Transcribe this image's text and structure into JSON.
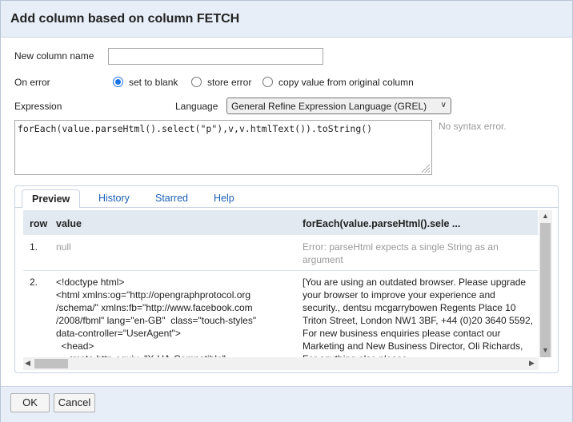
{
  "dialog": {
    "title": "Add column based on column FETCH"
  },
  "form": {
    "new_column_label": "New column name",
    "new_column_value": "",
    "on_error_label": "On error",
    "on_error_options": [
      "set to blank",
      "store error",
      "copy value from original column"
    ],
    "on_error_selected": "set to blank",
    "expression_label": "Expression",
    "language_label": "Language",
    "language_value": "General Refine Expression Language (GREL)",
    "expression_value": "forEach(value.parseHtml().select(\"p\"),v,v.htmlText()).toString()",
    "syntax_status": "No syntax error."
  },
  "tabs": [
    "Preview",
    "History",
    "Starred",
    "Help"
  ],
  "active_tab": "Preview",
  "preview": {
    "columns": [
      "row",
      "value",
      "forEach(value.parseHtml().sele ..."
    ],
    "rows": [
      {
        "row": "1.",
        "value": "null",
        "result": "Error: parseHtml expects a single String as an argument"
      },
      {
        "row": "2.",
        "value": "<!doctype html>\n<html xmlns:og=\"http://opengraphprotocol.org\n/schema/\" xmlns:fb=\"http://www.facebook.com\n/2008/fbml\" lang=\"en-GB\"  class=\"touch-styles\"\ndata-controller=\"UserAgent\">\n  <head>\n    <meta http-equiv=\"X-UA-Compatible\"",
        "result": "[You are using an outdated browser. Please upgrade your browser to improve your experience and security., dentsu mcgarrybowen Regents Place 10 Triton Street, London NW1 3BF, +44 (0)20 3640 5592, For new business enquiries please contact our Marketing and New Business Director, Oli Richards, For anything else please"
      }
    ]
  },
  "buttons": {
    "ok": "OK",
    "cancel": "Cancel"
  },
  "colors": {
    "accent": "#1a73e8",
    "header_bg": "#e8eef7",
    "link": "#1a5fb4"
  }
}
